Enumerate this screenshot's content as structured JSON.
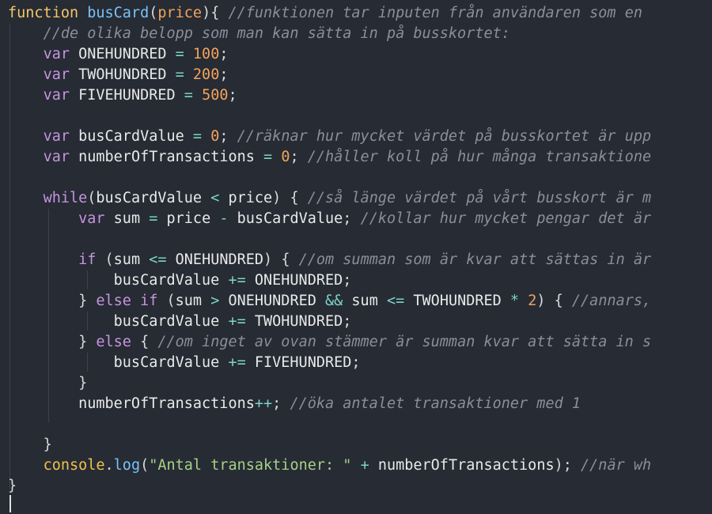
{
  "editor": {
    "colors": {
      "background": "#262b34",
      "keyword": "#f3c667",
      "var_keyword": "#c794e0",
      "function_name": "#7ac3f5",
      "number": "#f3a25c",
      "operator": "#7ed3c8",
      "comment": "#8a8f9a",
      "string": "#a7d187"
    },
    "lines": [
      [
        [
          "kw",
          "function"
        ],
        [
          "plain",
          " "
        ],
        [
          "fn",
          "busCard"
        ],
        [
          "punc",
          "("
        ],
        [
          "param",
          "price"
        ],
        [
          "punc",
          "){"
        ],
        [
          "plain",
          " "
        ],
        [
          "cmt",
          "//funktionen tar inputen från användaren som en"
        ]
      ],
      [
        [
          "plain",
          "    "
        ],
        [
          "cmt",
          "//de olika belopp som man kan sätta in på busskortet:"
        ]
      ],
      [
        [
          "plain",
          "    "
        ],
        [
          "kwv",
          "var"
        ],
        [
          "plain",
          " ONEHUNDRED "
        ],
        [
          "op",
          "="
        ],
        [
          "plain",
          " "
        ],
        [
          "num",
          "100"
        ],
        [
          "punc",
          ";"
        ]
      ],
      [
        [
          "plain",
          "    "
        ],
        [
          "kwv",
          "var"
        ],
        [
          "plain",
          " TWOHUNDRED "
        ],
        [
          "op",
          "="
        ],
        [
          "plain",
          " "
        ],
        [
          "num",
          "200"
        ],
        [
          "punc",
          ";"
        ]
      ],
      [
        [
          "plain",
          "    "
        ],
        [
          "kwv",
          "var"
        ],
        [
          "plain",
          " FIVEHUNDRED "
        ],
        [
          "op",
          "="
        ],
        [
          "plain",
          " "
        ],
        [
          "num",
          "500"
        ],
        [
          "punc",
          ";"
        ]
      ],
      [
        [
          "plain",
          ""
        ]
      ],
      [
        [
          "plain",
          "    "
        ],
        [
          "kwv",
          "var"
        ],
        [
          "plain",
          " busCardValue "
        ],
        [
          "op",
          "="
        ],
        [
          "plain",
          " "
        ],
        [
          "num",
          "0"
        ],
        [
          "punc",
          ";"
        ],
        [
          "plain",
          " "
        ],
        [
          "cmt",
          "//räknar hur mycket värdet på busskortet är upp"
        ]
      ],
      [
        [
          "plain",
          "    "
        ],
        [
          "kwv",
          "var"
        ],
        [
          "plain",
          " numberOfTransactions "
        ],
        [
          "op",
          "="
        ],
        [
          "plain",
          " "
        ],
        [
          "num",
          "0"
        ],
        [
          "punc",
          ";"
        ],
        [
          "plain",
          " "
        ],
        [
          "cmt",
          "//håller koll på hur många transaktione"
        ]
      ],
      [
        [
          "plain",
          ""
        ]
      ],
      [
        [
          "plain",
          "    "
        ],
        [
          "kwv",
          "while"
        ],
        [
          "punc",
          "("
        ],
        [
          "plain",
          "busCardValue "
        ],
        [
          "op",
          "<"
        ],
        [
          "plain",
          " price"
        ],
        [
          "punc",
          ")"
        ],
        [
          "plain",
          " "
        ],
        [
          "punc",
          "{"
        ],
        [
          "plain",
          " "
        ],
        [
          "cmt",
          "//så länge värdet på vårt busskort är m"
        ]
      ],
      [
        [
          "plain",
          "        "
        ],
        [
          "kwv",
          "var"
        ],
        [
          "plain",
          " sum "
        ],
        [
          "op",
          "="
        ],
        [
          "plain",
          " price "
        ],
        [
          "op",
          "-"
        ],
        [
          "plain",
          " busCardValue"
        ],
        [
          "punc",
          ";"
        ],
        [
          "plain",
          " "
        ],
        [
          "cmt",
          "//kollar hur mycket pengar det är"
        ]
      ],
      [
        [
          "plain",
          ""
        ]
      ],
      [
        [
          "plain",
          "        "
        ],
        [
          "kwv",
          "if"
        ],
        [
          "plain",
          " "
        ],
        [
          "punc",
          "("
        ],
        [
          "plain",
          "sum "
        ],
        [
          "op",
          "<="
        ],
        [
          "plain",
          " ONEHUNDRED"
        ],
        [
          "punc",
          ")"
        ],
        [
          "plain",
          " "
        ],
        [
          "punc",
          "{"
        ],
        [
          "plain",
          " "
        ],
        [
          "cmt",
          "//om summan som är kvar att sättas in är"
        ]
      ],
      [
        [
          "plain",
          "            busCardValue "
        ],
        [
          "op",
          "+="
        ],
        [
          "plain",
          " ONEHUNDRED"
        ],
        [
          "punc",
          ";"
        ]
      ],
      [
        [
          "plain",
          "        "
        ],
        [
          "punc",
          "}"
        ],
        [
          "plain",
          " "
        ],
        [
          "kwv",
          "else if"
        ],
        [
          "plain",
          " "
        ],
        [
          "punc",
          "("
        ],
        [
          "plain",
          "sum "
        ],
        [
          "op",
          ">"
        ],
        [
          "plain",
          " ONEHUNDRED "
        ],
        [
          "op",
          "&&"
        ],
        [
          "plain",
          " sum "
        ],
        [
          "op",
          "<="
        ],
        [
          "plain",
          " TWOHUNDRED "
        ],
        [
          "op",
          "*"
        ],
        [
          "plain",
          " "
        ],
        [
          "num",
          "2"
        ],
        [
          "punc",
          ")"
        ],
        [
          "plain",
          " "
        ],
        [
          "punc",
          "{"
        ],
        [
          "plain",
          " "
        ],
        [
          "cmt",
          "//annars,"
        ]
      ],
      [
        [
          "plain",
          "            busCardValue "
        ],
        [
          "op",
          "+="
        ],
        [
          "plain",
          " TWOHUNDRED"
        ],
        [
          "punc",
          ";"
        ]
      ],
      [
        [
          "plain",
          "        "
        ],
        [
          "punc",
          "}"
        ],
        [
          "plain",
          " "
        ],
        [
          "kwv",
          "else"
        ],
        [
          "plain",
          " "
        ],
        [
          "punc",
          "{"
        ],
        [
          "plain",
          " "
        ],
        [
          "cmt",
          "//om inget av ovan stämmer är summan kvar att sätta in s"
        ]
      ],
      [
        [
          "plain",
          "            busCardValue "
        ],
        [
          "op",
          "+="
        ],
        [
          "plain",
          " FIVEHUNDRED"
        ],
        [
          "punc",
          ";"
        ]
      ],
      [
        [
          "plain",
          "        "
        ],
        [
          "punc",
          "}"
        ]
      ],
      [
        [
          "plain",
          "        numberOfTransactions"
        ],
        [
          "op",
          "++"
        ],
        [
          "punc",
          ";"
        ],
        [
          "plain",
          " "
        ],
        [
          "cmt",
          "//öka antalet transaktioner med 1"
        ]
      ],
      [
        [
          "plain",
          ""
        ]
      ],
      [
        [
          "plain",
          "    "
        ],
        [
          "punc",
          "}"
        ]
      ],
      [
        [
          "plain",
          "    "
        ],
        [
          "obj",
          "console"
        ],
        [
          "punc",
          "."
        ],
        [
          "fn",
          "log"
        ],
        [
          "punc",
          "("
        ],
        [
          "str",
          "\"Antal transaktioner: \""
        ],
        [
          "plain",
          " "
        ],
        [
          "op",
          "+"
        ],
        [
          "plain",
          " numberOfTransactions"
        ],
        [
          "punc",
          ");"
        ],
        [
          "plain",
          " "
        ],
        [
          "cmt",
          "//när wh"
        ]
      ],
      [
        [
          "punc",
          "}"
        ]
      ]
    ]
  }
}
